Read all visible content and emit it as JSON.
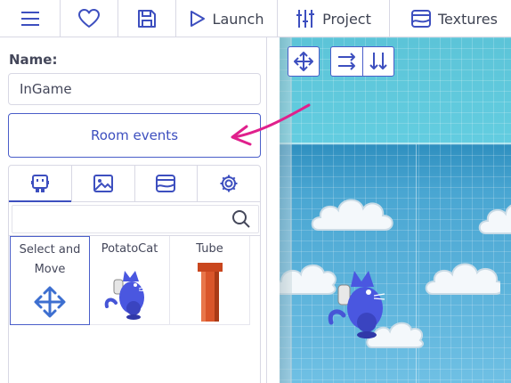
{
  "toolbar": {
    "menu_icon": "hamburger-menu-icon",
    "favorite_icon": "heart-icon",
    "save_icon": "floppy-disk-icon",
    "launch_label": "Launch",
    "project_label": "Project",
    "textures_label": "Textures"
  },
  "room": {
    "name_label": "Name:",
    "name_value": "InGame",
    "events_button": "Room events",
    "tabs": [
      "copies",
      "backgrounds",
      "tiles",
      "properties"
    ],
    "search_placeholder": "",
    "templates": [
      {
        "label": "Select and Move",
        "icon": "move-arrows-icon"
      },
      {
        "label": "PotatoCat",
        "icon": "potato-cat-sprite"
      },
      {
        "label": "Tube",
        "icon": "tube-sprite"
      }
    ]
  },
  "canvas": {
    "tools": [
      "move-tool-icon",
      "align-horizontal-icon",
      "align-vertical-icon"
    ]
  },
  "colors": {
    "accent": "#3d4fbf",
    "annotation_arrow": "#e0208c",
    "sky": "#53b8d8"
  }
}
